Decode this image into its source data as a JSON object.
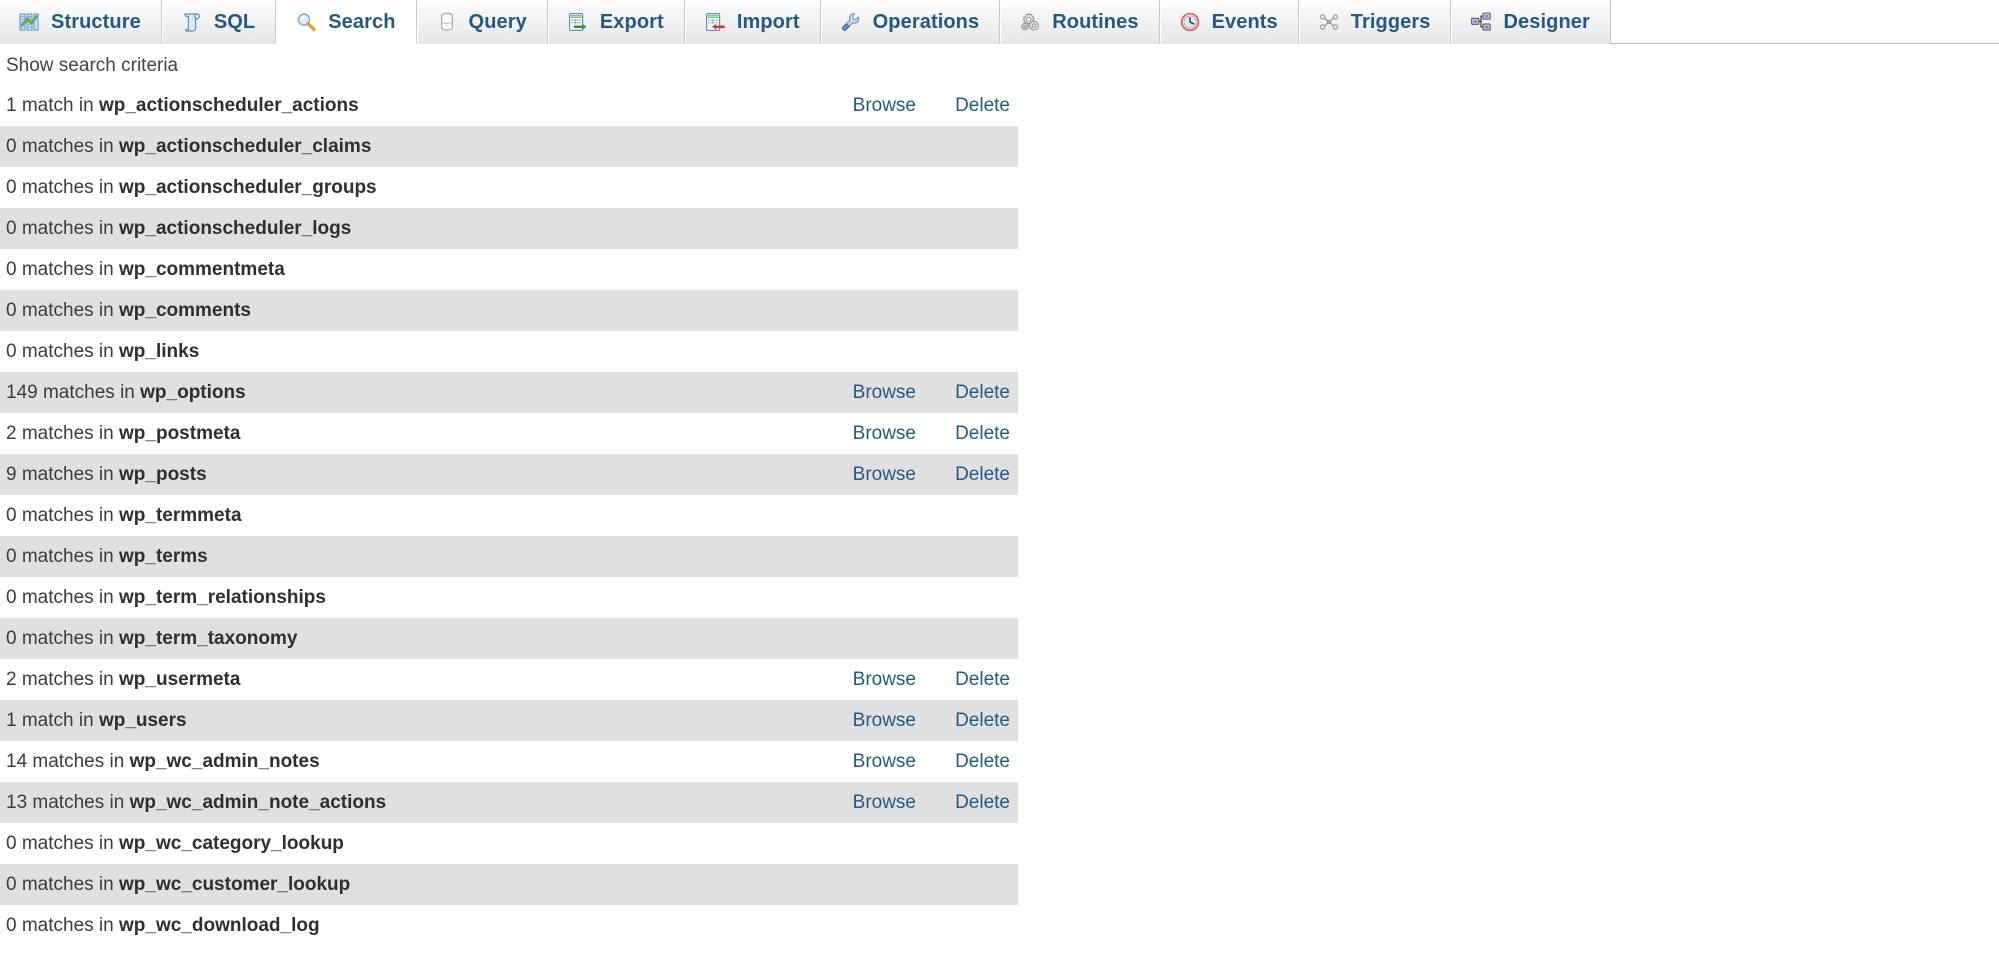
{
  "tabs": [
    {
      "label": "Structure",
      "icon": "structure-icon",
      "active": false
    },
    {
      "label": "SQL",
      "icon": "sql-scroll-icon",
      "active": false
    },
    {
      "label": "Search",
      "icon": "magnifier-icon",
      "active": true
    },
    {
      "label": "Query",
      "icon": "database-icon",
      "active": false
    },
    {
      "label": "Export",
      "icon": "export-icon",
      "active": false
    },
    {
      "label": "Import",
      "icon": "import-icon",
      "active": false
    },
    {
      "label": "Operations",
      "icon": "wrench-icon",
      "active": false
    },
    {
      "label": "Routines",
      "icon": "gears-icon",
      "active": false
    },
    {
      "label": "Events",
      "icon": "clock-icon",
      "active": false
    },
    {
      "label": "Triggers",
      "icon": "triggers-icon",
      "active": false
    },
    {
      "label": "Designer",
      "icon": "designer-icon",
      "active": false
    }
  ],
  "search": {
    "criteria_link": "Show search criteria",
    "browse_label": "Browse",
    "delete_label": "Delete"
  },
  "colors": {
    "link": "#235a81",
    "tab_label": "#235a81",
    "row_even": "#e0e0e0",
    "row_odd": "#ffffff",
    "text": "#3c3c3c"
  },
  "results": [
    {
      "count_text": "1 match in",
      "table": "wp_actionscheduler_actions",
      "matches": 1,
      "has_actions": true
    },
    {
      "count_text": "0 matches in",
      "table": "wp_actionscheduler_claims",
      "matches": 0,
      "has_actions": false
    },
    {
      "count_text": "0 matches in",
      "table": "wp_actionscheduler_groups",
      "matches": 0,
      "has_actions": false
    },
    {
      "count_text": "0 matches in",
      "table": "wp_actionscheduler_logs",
      "matches": 0,
      "has_actions": false
    },
    {
      "count_text": "0 matches in",
      "table": "wp_commentmeta",
      "matches": 0,
      "has_actions": false
    },
    {
      "count_text": "0 matches in",
      "table": "wp_comments",
      "matches": 0,
      "has_actions": false
    },
    {
      "count_text": "0 matches in",
      "table": "wp_links",
      "matches": 0,
      "has_actions": false
    },
    {
      "count_text": "149 matches in",
      "table": "wp_options",
      "matches": 149,
      "has_actions": true
    },
    {
      "count_text": "2 matches in",
      "table": "wp_postmeta",
      "matches": 2,
      "has_actions": true
    },
    {
      "count_text": "9 matches in",
      "table": "wp_posts",
      "matches": 9,
      "has_actions": true
    },
    {
      "count_text": "0 matches in",
      "table": "wp_termmeta",
      "matches": 0,
      "has_actions": false
    },
    {
      "count_text": "0 matches in",
      "table": "wp_terms",
      "matches": 0,
      "has_actions": false
    },
    {
      "count_text": "0 matches in",
      "table": "wp_term_relationships",
      "matches": 0,
      "has_actions": false
    },
    {
      "count_text": "0 matches in",
      "table": "wp_term_taxonomy",
      "matches": 0,
      "has_actions": false
    },
    {
      "count_text": "2 matches in",
      "table": "wp_usermeta",
      "matches": 2,
      "has_actions": true
    },
    {
      "count_text": "1 match in",
      "table": "wp_users",
      "matches": 1,
      "has_actions": true
    },
    {
      "count_text": "14 matches in",
      "table": "wp_wc_admin_notes",
      "matches": 14,
      "has_actions": true
    },
    {
      "count_text": "13 matches in",
      "table": "wp_wc_admin_note_actions",
      "matches": 13,
      "has_actions": true
    },
    {
      "count_text": "0 matches in",
      "table": "wp_wc_category_lookup",
      "matches": 0,
      "has_actions": false
    },
    {
      "count_text": "0 matches in",
      "table": "wp_wc_customer_lookup",
      "matches": 0,
      "has_actions": false
    },
    {
      "count_text": "0 matches in",
      "table": "wp_wc_download_log",
      "matches": 0,
      "has_actions": false
    }
  ]
}
